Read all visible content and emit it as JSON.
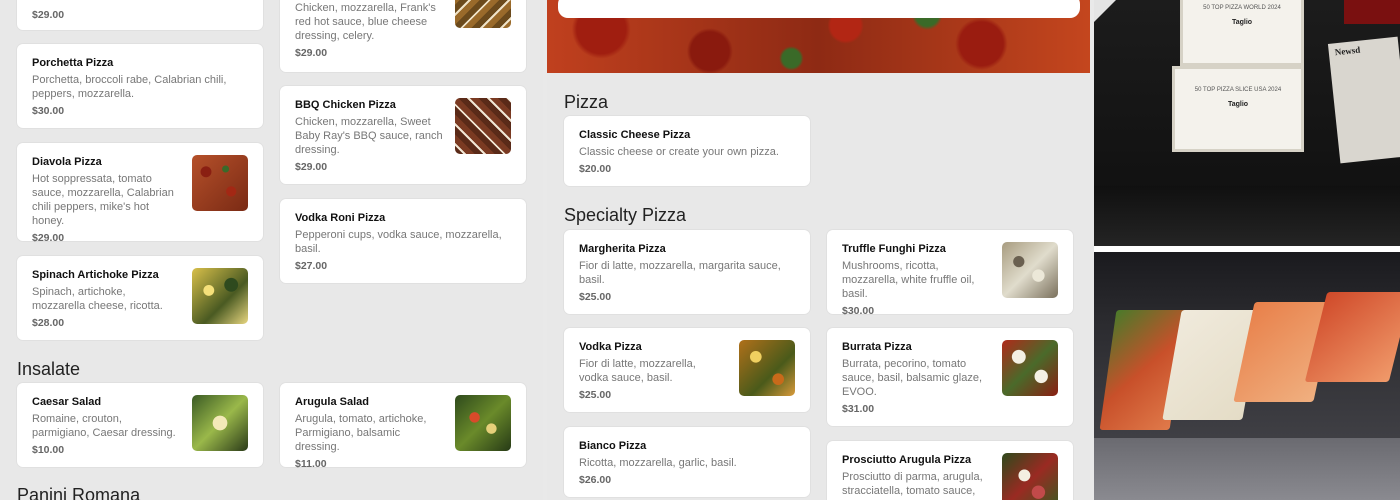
{
  "left": {
    "sections": [
      {
        "title": "Insalate"
      },
      {
        "title": "Panini Romana"
      }
    ],
    "items": [
      {
        "price": "$29.00"
      },
      {
        "name": "Porchetta Pizza",
        "desc": "Porchetta, broccoli rabe, Calabrian chili, peppers, mozzarella.",
        "price": "$30.00"
      },
      {
        "name": "Diavola Pizza",
        "desc": "Hot soppressata, tomato sauce, mozzarella, Calabrian chili peppers, mike's hot honey.",
        "price": "$29.00"
      },
      {
        "name": "Spinach Artichoke Pizza",
        "desc": "Spinach, artichoke, mozzarella cheese, ricotta.",
        "price": "$28.00"
      },
      {
        "name": "Caesar Salad",
        "desc": "Romaine, crouton, parmigiano, Caesar dressing.",
        "price": "$10.00"
      },
      {
        "desc": "Chicken, mozzarella, Frank's red hot sauce, blue cheese dressing, celery.",
        "price": "$29.00"
      },
      {
        "name": "BBQ Chicken Pizza",
        "desc": "Chicken, mozzarella, Sweet Baby Ray's BBQ sauce, ranch dressing.",
        "price": "$29.00"
      },
      {
        "name": "Vodka Roni Pizza",
        "desc": "Pepperoni cups, vodka sauce, mozzarella, basil.",
        "price": "$27.00"
      },
      {
        "name": "Arugula Salad",
        "desc": "Arugula, tomato, artichoke, Parmigiano, balsamic dressing.",
        "price": "$11.00"
      }
    ]
  },
  "middle": {
    "sections": [
      {
        "title": "Pizza"
      },
      {
        "title": "Specialty Pizza"
      }
    ],
    "items": [
      {
        "name": "Classic Cheese Pizza",
        "desc": "Classic cheese or create your own pizza.",
        "price": "$20.00"
      },
      {
        "name": "Margherita Pizza",
        "desc": "Fior di latte, mozzarella, margarita sauce, basil.",
        "price": "$25.00"
      },
      {
        "name": "Vodka Pizza",
        "desc": "Fior di latte, mozzarella, vodka sauce, basil.",
        "price": "$25.00"
      },
      {
        "name": "Bianco Pizza",
        "desc": "Ricotta, mozzarella, garlic, basil.",
        "price": "$26.00"
      },
      {
        "name": "Truffle Funghi Pizza",
        "desc": "Mushrooms, ricotta, mozzarella, white fruffle oil, basil.",
        "price": "$30.00"
      },
      {
        "name": "Burrata Pizza",
        "desc": "Burrata, pecorino, tomato sauce, basil, balsamic glaze, EVOO.",
        "price": "$31.00"
      },
      {
        "name": "Prosciutto Arugula Pizza",
        "desc": "Prosciutto di parma, arugula, stracciatella, tomato sauce,",
        "price": ""
      }
    ]
  },
  "right": {
    "award_top": {
      "heading": "50 TOP PIZZA WORLD 2024",
      "name": "Taglio"
    },
    "award_bottom": {
      "heading": "50 TOP PIZZA SLICE USA 2024",
      "name": "Taglio"
    },
    "sign": "Newsd"
  },
  "icons": [
    "pizza-photo",
    "salad-photo",
    "award-frame",
    "tray-photo"
  ]
}
